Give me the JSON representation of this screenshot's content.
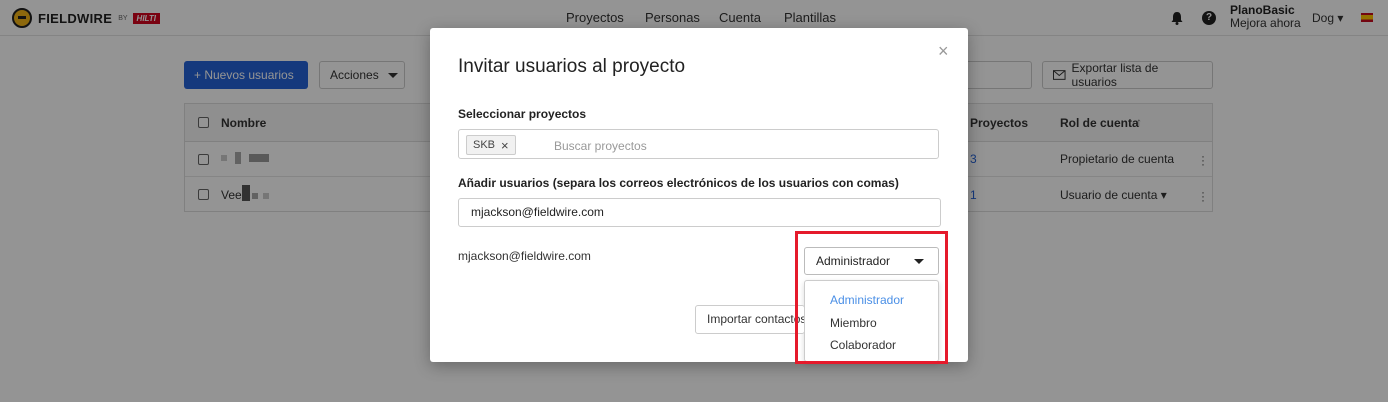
{
  "header": {
    "logo_text": "FIELDWIRE",
    "logo_by": "BY",
    "logo_partner": "HILTI",
    "nav": [
      "Proyectos",
      "Personas",
      "Cuenta",
      "Plantillas"
    ],
    "plan_name": "PlanoBasic",
    "plan_upgrade": "Mejora ahora",
    "user_label": "Dog ▾",
    "icons": {
      "notifications": "bell-icon",
      "help": "help-icon",
      "language": "spain-flag-icon"
    }
  },
  "toolbar": {
    "new_users_label": "+ Nuevos usuarios",
    "actions_label": "Acciones",
    "export_label": "Exportar lista de usuarios"
  },
  "table": {
    "headers": {
      "name": "Nombre",
      "projects": "Proyectos",
      "role": "Rol de cuenta"
    },
    "sort_icon": "arrow-up-icon",
    "rows": [
      {
        "name": "",
        "projects": "3",
        "role": "Propietario de cuenta"
      },
      {
        "name": "Vee",
        "projects": "1",
        "role": "Usuario de cuenta ▾"
      }
    ]
  },
  "modal": {
    "title": "Invitar usuarios al proyecto",
    "select_projects_label": "Seleccionar proyectos",
    "selected_project_chip": "SKB",
    "projects_placeholder": "Buscar proyectos",
    "add_users_label": "Añadir usuarios (separa los correos electrónicos de los usuarios con comas)",
    "email_value": "mjackson@fieldwire.com",
    "invitee_email": "mjackson@fieldwire.com",
    "role_selected": "Administrador",
    "role_options": [
      "Administrador",
      "Miembro",
      "Colaborador"
    ],
    "import_button_label": "Importar contactos"
  },
  "colors": {
    "primary": "#2563d8",
    "selected_option": "#4a8fe6",
    "highlight": "#e51a2b"
  }
}
